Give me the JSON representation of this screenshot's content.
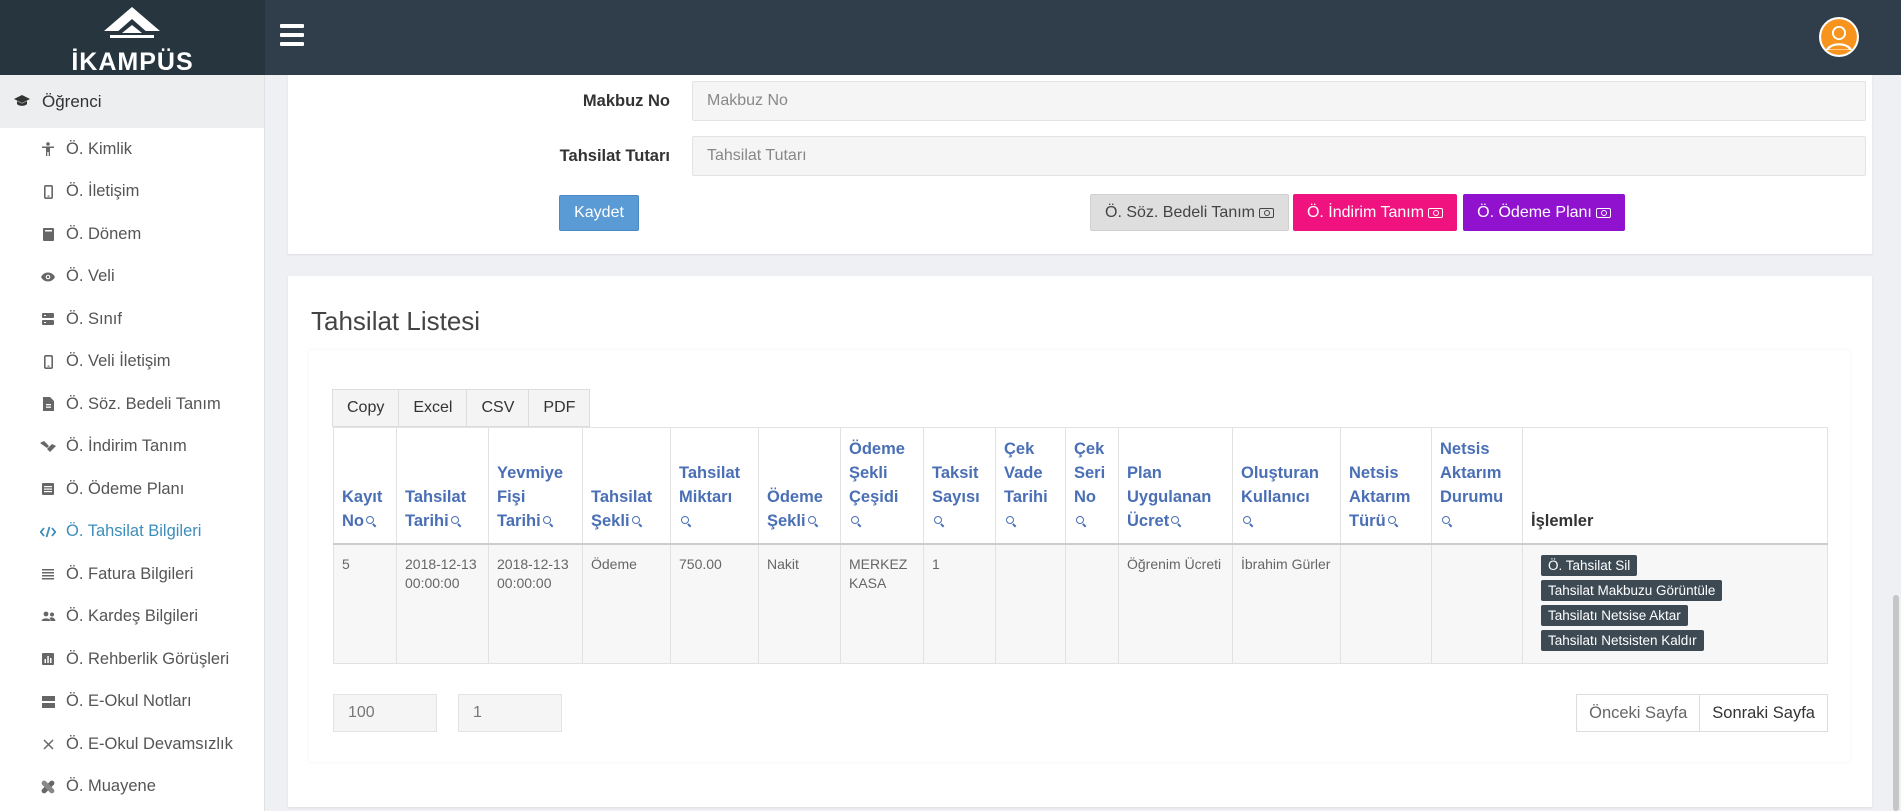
{
  "brand": {
    "name": "İKAMPÜS"
  },
  "colors": {
    "topbar": "#2f3e4a",
    "active": "#3c8dbc",
    "save": "#5b9bd5",
    "pink": "#f0137f",
    "purple": "#9012cf"
  },
  "sidebar": {
    "header": {
      "label": "Öğrenci",
      "icon": "graduation-cap-icon"
    },
    "items": [
      {
        "label": "Ö. Kimlik",
        "icon": "person-icon"
      },
      {
        "label": "Ö. İletişim",
        "icon": "mobile-icon"
      },
      {
        "label": "Ö. Dönem",
        "icon": "book-icon"
      },
      {
        "label": "Ö. Veli",
        "icon": "eye-icon"
      },
      {
        "label": "Ö. Sınıf",
        "icon": "server-icon"
      },
      {
        "label": "Ö. Veli İletişim",
        "icon": "mobile-icon"
      },
      {
        "label": "Ö. Söz. Bedeli Tanım",
        "icon": "file-icon"
      },
      {
        "label": "Ö. İndirim Tanım",
        "icon": "handshake-icon"
      },
      {
        "label": "Ö. Ödeme Planı",
        "icon": "list-icon"
      },
      {
        "label": "Ö. Tahsilat Bilgileri",
        "icon": "code-icon"
      },
      {
        "label": "Ö. Fatura Bilgileri",
        "icon": "lines-icon"
      },
      {
        "label": "Ö. Kardeş Bilgileri",
        "icon": "users-icon"
      },
      {
        "label": "Ö. Rehberlik Görüşleri",
        "icon": "chart-icon"
      },
      {
        "label": "Ö. E-Okul Notları",
        "icon": "panel-icon"
      },
      {
        "label": "Ö. E-Okul Devamsızlık",
        "icon": "close-icon"
      },
      {
        "label": "Ö. Muayene",
        "icon": "bandage-icon"
      }
    ]
  },
  "form": {
    "makbuz_label": "Makbuz No",
    "makbuz_placeholder": "Makbuz No",
    "tutar_label": "Tahsilat Tutarı",
    "tutar_placeholder": "Tahsilat Tutarı",
    "save_label": "Kaydet",
    "soz_label": "Ö. Söz. Bedeli Tanım",
    "indirim_label": "Ö. İndirim Tanım",
    "odeme_label": "Ö. Ödeme Planı"
  },
  "list": {
    "title": "Tahsilat Listesi",
    "export": [
      "Copy",
      "Excel",
      "CSV",
      "PDF"
    ],
    "columns": [
      [
        "Kayıt",
        "No"
      ],
      [
        "Tahsilat",
        "Tarihi"
      ],
      [
        "Yevmiye",
        "Fişi",
        "Tarihi"
      ],
      [
        "Tahsilat",
        "Şekli"
      ],
      [
        "Tahsilat",
        "Miktarı",
        ""
      ],
      [
        "Ödeme",
        "Şekli"
      ],
      [
        "Ödeme",
        "Şekli",
        "Çeşidi",
        ""
      ],
      [
        "Taksit",
        "Sayısı",
        ""
      ],
      [
        "Çek",
        "Vade",
        "Tarihi",
        ""
      ],
      [
        "Çek",
        "Seri",
        "No",
        ""
      ],
      [
        "Plan",
        "Uygulanan",
        "Ücret"
      ],
      [
        "Oluşturan",
        "Kullanıcı",
        ""
      ],
      [
        "Netsis",
        "Aktarım",
        "Türü"
      ],
      [
        "Netsis",
        "Aktarım",
        "Durumu",
        ""
      ],
      [
        "İşlemler"
      ]
    ],
    "rows": [
      [
        "5",
        "2018-12-13 00:00:00",
        "2018-12-13 00:00:00",
        "Ödeme",
        "750.00",
        "Nakit",
        "MERKEZ KASA",
        "1",
        "",
        "",
        "Öğrenim Ücreti",
        "İbrahim Gürler",
        "",
        ""
      ]
    ],
    "row_actions": [
      "Ö. Tahsilat Sil",
      "Tahsilat Makbuzu Görüntüle",
      "Tahsilatı Netsise Aktar",
      "Tahsilatı Netsisten Kaldır"
    ],
    "page_size": "100",
    "page_number": "1",
    "prev_label": "Önceki Sayfa",
    "next_label": "Sonraki Sayfa"
  }
}
